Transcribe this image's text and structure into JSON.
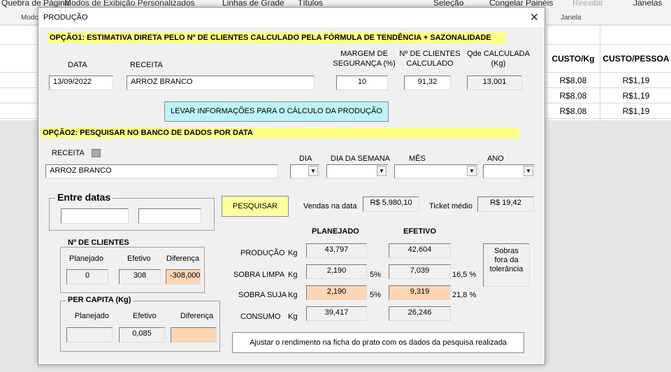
{
  "excel": {
    "ribbon": {
      "page_break": "Quebra de Página",
      "custom_views": "Modos de Exibição Personalizados",
      "gridlines": "Linhas de Grade",
      "titles": "Títulos",
      "selection": "Seleção",
      "freeze_panes": "Congelar Painéis",
      "unhide": "Reexibir",
      "windows": "Janelas",
      "group_mode": "Modo",
      "group_window": "Janela"
    },
    "headers": {
      "cost_kg": "CUSTO/Kg",
      "cost_person": "CUSTO/PESSOA"
    },
    "rows": [
      {
        "cost_kg": "R$8,08",
        "cost_person": "R$1,19"
      },
      {
        "cost_kg": "R$8,08",
        "cost_person": "R$1,19"
      },
      {
        "cost_kg": "R$8,08",
        "cost_person": "R$1,19"
      }
    ]
  },
  "dialog": {
    "title": "PRODUÇÃO",
    "close": "✕",
    "option1": {
      "banner": "OPÇÃO1: ESTIMATIVA DIRETA PELO Nº DE CLIENTES CALCULADO PELA FÓRMULA DE TENDÊNCIA + SAZONALIDADE",
      "date_label": "DATA",
      "recipe_label": "RECEITA",
      "margin_label": [
        "MARGEM DE",
        "SEGURANÇA (%)"
      ],
      "clients_label": [
        "Nº DE CLIENTES",
        "CALCULADO"
      ],
      "qty_label": [
        "Qde CALCULADA",
        "(Kg)"
      ],
      "date_value": "13/09/2022",
      "recipe_value": "ARROZ BRANCO",
      "margin_value": "10",
      "clients_value": "91,32",
      "qty_value": "13,001",
      "button": "LEVAR INFORMAÇÕES PARA O CÁLCULO DA PRODUÇÃO"
    },
    "option2": {
      "banner": "OPÇÃO2: PESQUISAR NO BANCO DE DADOS POR DATA",
      "recipe_label": "RECEITA",
      "recipe_value": "ARROZ BRANCO",
      "day_label": "DIA",
      "weekday_label": "DIA DA SEMANA",
      "month_label": "MÊS",
      "year_label": "ANO",
      "between_dates": "Entre datas",
      "search_button": "PESQUISAR",
      "sales_label": "Vendas na data",
      "sales_value": "R$ 5.980,10",
      "ticket_label": "Ticket médio",
      "ticket_value": "R$ 19,42",
      "clients_frame": {
        "title": "Nº DE CLIENTES",
        "planned_label": "Planejado",
        "actual_label": "Efetivo",
        "diff_label": "Diferença",
        "planned": "0",
        "actual": "308",
        "diff": "-308,000"
      },
      "per_capita_frame": {
        "title": "PER CAPITA (Kg)",
        "planned_label": "Planejado",
        "actual_label": "Efetivo",
        "diff_label": "Diferença",
        "planned": "",
        "actual": "0,085",
        "diff": ""
      },
      "planned_header": "PLANEJADO",
      "actual_header": "EFETIVO",
      "rows": [
        {
          "label": "PRODUÇÃO",
          "unit": "Kg",
          "planned": "43,797",
          "planned_pct": "",
          "actual": "42,604",
          "actual_pct": ""
        },
        {
          "label": "SOBRA LIMPA",
          "unit": "Kg",
          "planned": "2,190",
          "planned_pct": "5%",
          "actual": "7,039",
          "actual_pct": "16,5 %"
        },
        {
          "label": "SOBRA SUJA",
          "unit": "Kg",
          "planned": "2,190",
          "planned_pct": "5%",
          "actual": "9,319",
          "actual_pct": "21,8 %"
        },
        {
          "label": "CONSUMO",
          "unit": "Kg",
          "planned": "39,417",
          "planned_pct": "",
          "actual": "26,246",
          "actual_pct": ""
        }
      ],
      "tolerance_box": [
        "Sobras",
        "fora da",
        "tolerância"
      ],
      "adjust_button": "Ajustar o rendimento na ficha do prato com os dados da pesquisa realizada"
    }
  }
}
